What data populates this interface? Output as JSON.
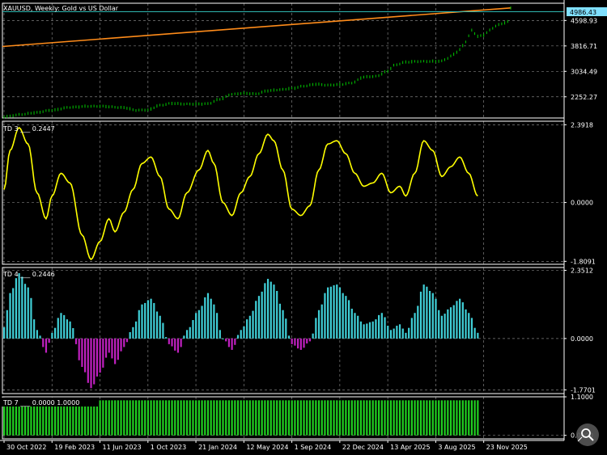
{
  "title": "XAUUSD, Weekly:  Gold vs US Dollar",
  "colors": {
    "background": "#000000",
    "grid": "#7f7f7f",
    "axis": "#ffffff",
    "price": "#00c800",
    "trendline": "#ff8c1a",
    "td3_line": "#ffff00",
    "hist_positive": "#40d0d8",
    "hist_negative": "#c020c0",
    "td7_bars": "#20d020",
    "price_tag": "#80e0ff",
    "close_line": "#2fb7b0"
  },
  "price_panel": {
    "current_price": "4986.43",
    "ticks": [
      {
        "value": 4598.93,
        "label": "4598.93"
      },
      {
        "value": 3816.71,
        "label": "3816.71"
      },
      {
        "value": 3034.49,
        "label": "3034.49"
      },
      {
        "value": 2252.27,
        "label": "2252.27"
      }
    ],
    "ymin": 1600,
    "ymax": 5130,
    "trendline": {
      "start": 3800,
      "end": 4986.43
    }
  },
  "td3_panel": {
    "label": "TD 3 ___ 0.2447",
    "ticks": [
      {
        "value": 2.3918,
        "label": "2.3918"
      },
      {
        "value": 0.0,
        "label": "0.0000"
      },
      {
        "value": -1.8091,
        "label": "-1.8091"
      }
    ],
    "ymin": -1.9,
    "ymax": 2.5
  },
  "td4_panel": {
    "label": "TD 4 ___ 0.2446",
    "ticks": [
      {
        "value": 2.3512,
        "label": "2.3512"
      },
      {
        "value": 0.0,
        "label": "0.0000"
      },
      {
        "value": -1.7701,
        "label": "-1.7701"
      }
    ],
    "ymin": -1.9,
    "ymax": 2.45
  },
  "td7_panel": {
    "label": "TD 7 ___ 0.0000 1.0000",
    "ticks": [
      {
        "value": 1.1,
        "label": "1.1000"
      },
      {
        "value": 0.0,
        "label": "0.0000"
      }
    ],
    "ymin": -0.1,
    "ymax": 1.1
  },
  "time_axis": [
    {
      "week": 0,
      "label": "30 Oct 2022"
    },
    {
      "week": 16,
      "label": "19 Feb 2023"
    },
    {
      "week": 32,
      "label": "11 Jun 2023"
    },
    {
      "week": 48,
      "label": "1 Oct 2023"
    },
    {
      "week": 64,
      "label": "21 Jan 2024"
    },
    {
      "week": 80,
      "label": "12 May 2024"
    },
    {
      "week": 96,
      "label": "1 Sep 2024"
    },
    {
      "week": 112,
      "label": "22 Dec 2024"
    },
    {
      "week": 128,
      "label": "13 Apr 2025"
    },
    {
      "week": 144,
      "label": "3 Aug 2025"
    },
    {
      "week": 160,
      "label": "23 Nov 2025"
    }
  ],
  "chart_data": {
    "type": "line",
    "weeks_total": 170,
    "price_keypoints": [
      [
        0,
        1640
      ],
      [
        6,
        1710
      ],
      [
        10,
        1760
      ],
      [
        16,
        1840
      ],
      [
        22,
        1930
      ],
      [
        28,
        1960
      ],
      [
        32,
        1960
      ],
      [
        40,
        1920
      ],
      [
        44,
        1840
      ],
      [
        48,
        1850
      ],
      [
        52,
        1990
      ],
      [
        56,
        2050
      ],
      [
        60,
        2030
      ],
      [
        64,
        2030
      ],
      [
        68,
        2040
      ],
      [
        72,
        2180
      ],
      [
        76,
        2330
      ],
      [
        80,
        2360
      ],
      [
        84,
        2340
      ],
      [
        88,
        2440
      ],
      [
        92,
        2470
      ],
      [
        96,
        2510
      ],
      [
        100,
        2580
      ],
      [
        104,
        2640
      ],
      [
        108,
        2610
      ],
      [
        112,
        2630
      ],
      [
        116,
        2680
      ],
      [
        120,
        2860
      ],
      [
        124,
        2880
      ],
      [
        128,
        3040
      ],
      [
        130,
        3220
      ],
      [
        134,
        3320
      ],
      [
        138,
        3340
      ],
      [
        142,
        3340
      ],
      [
        146,
        3350
      ],
      [
        148,
        3440
      ],
      [
        150,
        3560
      ],
      [
        152,
        3700
      ],
      [
        154,
        3950
      ],
      [
        156,
        4300
      ],
      [
        158,
        4110
      ],
      [
        160,
        4150
      ],
      [
        162,
        4300
      ],
      [
        164,
        4430
      ],
      [
        166,
        4500
      ],
      [
        168,
        4560
      ],
      [
        169,
        4986
      ]
    ],
    "td3_keypoints": [
      [
        0,
        0.4
      ],
      [
        2,
        1.6
      ],
      [
        5,
        2.3
      ],
      [
        8,
        1.8
      ],
      [
        11,
        0.3
      ],
      [
        14,
        -0.5
      ],
      [
        16,
        0.2
      ],
      [
        19,
        0.9
      ],
      [
        22,
        0.6
      ],
      [
        26,
        -1.0
      ],
      [
        29,
        -1.75
      ],
      [
        32,
        -1.2
      ],
      [
        35,
        -0.5
      ],
      [
        37,
        -0.9
      ],
      [
        40,
        -0.3
      ],
      [
        43,
        0.4
      ],
      [
        46,
        1.2
      ],
      [
        49,
        1.4
      ],
      [
        52,
        0.8
      ],
      [
        55,
        -0.2
      ],
      [
        58,
        -0.5
      ],
      [
        61,
        0.3
      ],
      [
        65,
        1.0
      ],
      [
        68,
        1.6
      ],
      [
        70,
        1.2
      ],
      [
        73,
        0.0
      ],
      [
        76,
        -0.4
      ],
      [
        79,
        0.3
      ],
      [
        82,
        0.8
      ],
      [
        85,
        1.5
      ],
      [
        88,
        2.1
      ],
      [
        90,
        1.9
      ],
      [
        93,
        1.0
      ],
      [
        96,
        -0.2
      ],
      [
        99,
        -0.4
      ],
      [
        102,
        -0.1
      ],
      [
        105,
        1.0
      ],
      [
        108,
        1.8
      ],
      [
        111,
        1.9
      ],
      [
        114,
        1.5
      ],
      [
        117,
        0.9
      ],
      [
        120,
        0.5
      ],
      [
        123,
        0.6
      ],
      [
        126,
        0.9
      ],
      [
        129,
        0.3
      ],
      [
        132,
        0.5
      ],
      [
        134,
        0.2
      ],
      [
        137,
        0.9
      ],
      [
        140,
        1.9
      ],
      [
        143,
        1.6
      ],
      [
        146,
        0.8
      ],
      [
        149,
        1.1
      ],
      [
        152,
        1.4
      ],
      [
        155,
        0.9
      ],
      [
        158,
        0.2
      ]
    ],
    "td7_value": 1.0
  }
}
